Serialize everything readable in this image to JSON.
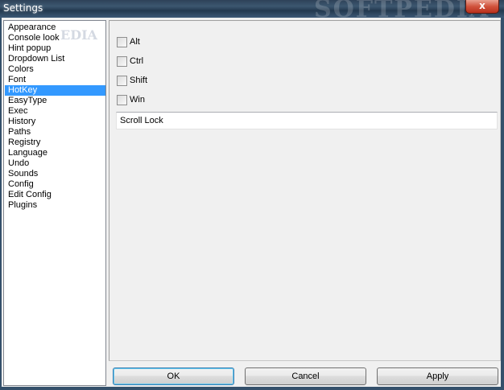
{
  "window": {
    "title": "Settings",
    "close_glyph": "x",
    "watermark": "SOFTPEDIA",
    "watermark_small": "EDIA"
  },
  "sidebar": {
    "selected_index": 6,
    "items": [
      {
        "label": "Appearance"
      },
      {
        "label": "Console look"
      },
      {
        "label": "Hint popup"
      },
      {
        "label": "Dropdown List"
      },
      {
        "label": "Colors"
      },
      {
        "label": "Font"
      },
      {
        "label": "HotKey"
      },
      {
        "label": "EasyType"
      },
      {
        "label": "Exec"
      },
      {
        "label": "History"
      },
      {
        "label": "Paths"
      },
      {
        "label": "Registry"
      },
      {
        "label": "Language"
      },
      {
        "label": "Undo"
      },
      {
        "label": "Sounds"
      },
      {
        "label": "Config"
      },
      {
        "label": "Edit Config"
      },
      {
        "label": "Plugins"
      }
    ]
  },
  "hotkey": {
    "modifiers": [
      {
        "label": "Alt",
        "checked": false
      },
      {
        "label": "Ctrl",
        "checked": false
      },
      {
        "label": "Shift",
        "checked": false
      },
      {
        "label": "Win",
        "checked": false
      }
    ],
    "key_value": "Scroll Lock"
  },
  "buttons": {
    "ok": "OK",
    "cancel": "Cancel",
    "apply": "Apply"
  },
  "colors": {
    "selection": "#3399ff",
    "titlebar": "#34506b",
    "close": "#c7412b"
  },
  "icons": {
    "close": "close-icon"
  }
}
